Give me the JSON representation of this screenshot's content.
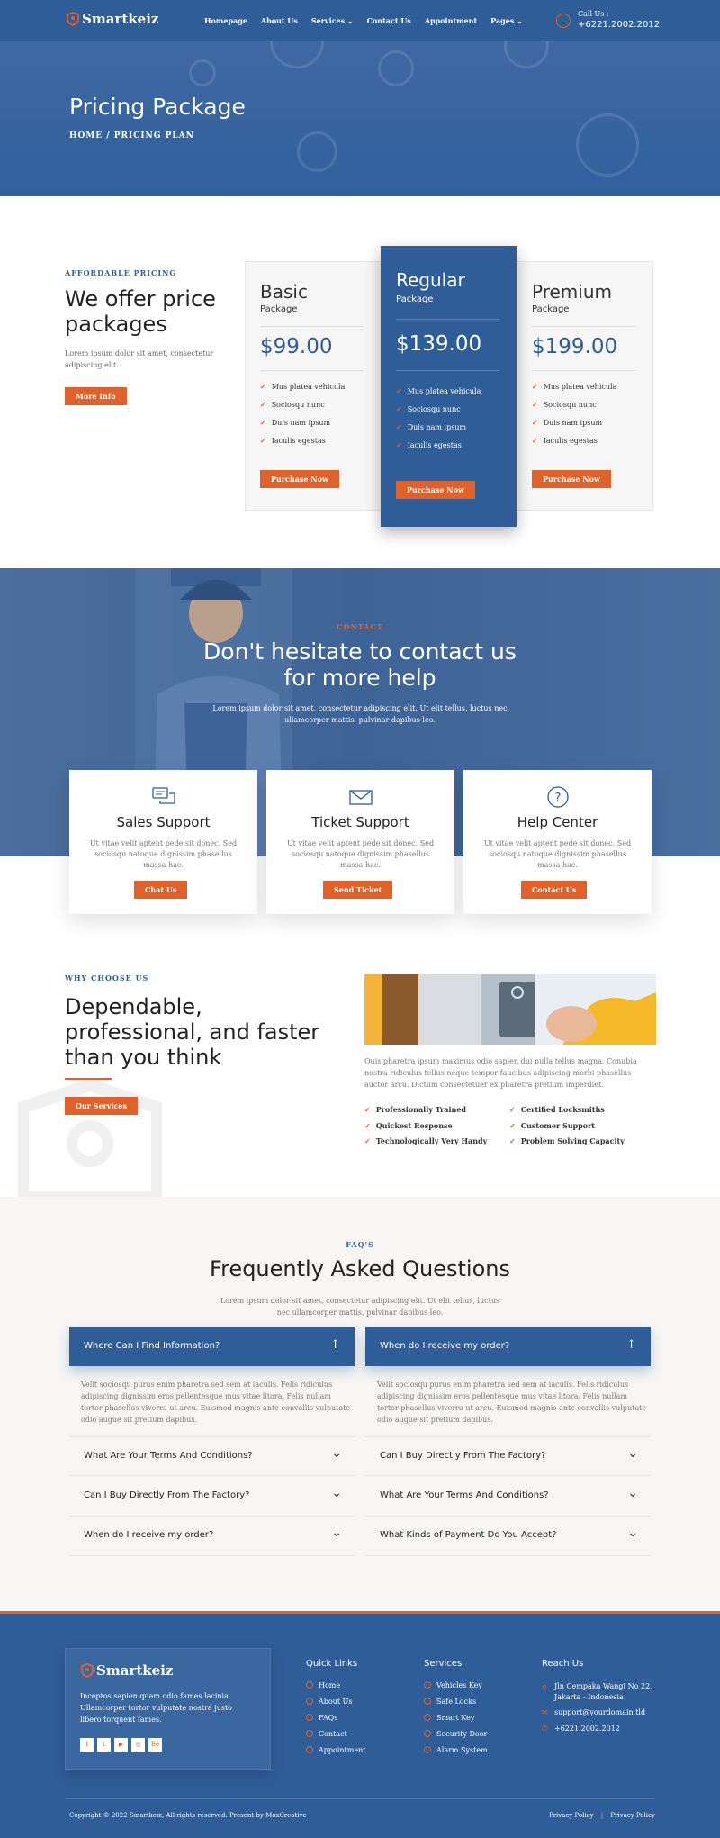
{
  "header": {
    "logo": "Smartkeiz",
    "nav": [
      "Homepage",
      "About Us",
      "Services",
      "Contact Us",
      "Appointment",
      "Pages"
    ],
    "call_label": "Call Us :",
    "call_number": "+6221.2002.2012"
  },
  "hero": {
    "title": "Pricing Package",
    "breadcrumb": "HOME  /  PRICING PLAN"
  },
  "pricing": {
    "eyebrow": "AFFORDABLE PRICING",
    "title": "We offer price packages",
    "desc": "Lorem ipsum dolor sit amet, consectetur adipiscing elit.",
    "more_btn": "More Info",
    "plans": [
      {
        "name": "Basic",
        "sub": "Package",
        "price": "$99.00",
        "features": [
          "Mus platea vehicula",
          "Sociosqu nunc",
          "Duis nam ipsum",
          "Iaculis egestas"
        ],
        "btn": "Purchase Now"
      },
      {
        "name": "Regular",
        "sub": "Package",
        "price": "$139.00",
        "features": [
          "Mus platea vehicula",
          "Sociosqu nunc",
          "Duis nam ipsum",
          "Iaculis egestas"
        ],
        "btn": "Purchase Now"
      },
      {
        "name": "Premium",
        "sub": "Package",
        "price": "$199.00",
        "features": [
          "Mus platea vehicula",
          "Sociosqu nunc",
          "Duis nam ipsum",
          "Iaculis egestas"
        ],
        "btn": "Purchase Now"
      }
    ]
  },
  "contact": {
    "eyebrow": "CONTACT",
    "title": "Don't hesitate to contact us for more help",
    "desc": "Lorem ipsum dolor sit amet, consectetur adipiscing elit. Ut elit tellus, luctus nec ullamcorper mattis, pulvinar dapibus leo.",
    "cards": [
      {
        "icon": "chat-bubbles-icon",
        "title": "Sales Support",
        "text": "Ut vitae velit aptent pede sit donec. Sed sociosqu natoque dignissim phasellus massa hac.",
        "btn": "Chat Us"
      },
      {
        "icon": "envelope-icon",
        "title": "Ticket Support",
        "text": "Ut vitae velit aptent pede sit donec. Sed sociosqu natoque dignissim phasellus massa hac.",
        "btn": "Send Ticket"
      },
      {
        "icon": "question-circle-icon",
        "title": "Help Center",
        "text": "Ut vitae velit aptent pede sit donec. Sed sociosqu natoque dignissim phasellus massa hac.",
        "btn": "Contact Us"
      }
    ]
  },
  "why": {
    "eyebrow": "WHY CHOOSE US",
    "title": "Dependable, professional, and faster than you think",
    "btn": "Our Services",
    "desc": "Quis pharetra ipsum maximus odio sapien dui nulla tellus magna. Conubia nostra ridiculus tellus neque tempor faucibus adipiscing morbi phasellus auctor arcu. Dictum consectetuer ex pharetra pretium imperdiet.",
    "features": [
      "Professionally Trained",
      "Certified Locksmiths",
      "Quickest Response",
      "Customer Support",
      "Technologically Very Handy",
      "Problem Solving Capacity"
    ]
  },
  "faq": {
    "eyebrow": "FAQ'S",
    "title": "Frequently Asked Questions",
    "desc": "Lorem ipsum dolor sit amet, consectetur adipiscing elit. Ut elit tellus, luctus nec ullamcorper mattis, pulvinar dapibus leo.",
    "answer": "Velit sociosqu purus enim pharetra sed sem at iaculis. Felis ridiculus adipiscing dignissim eros pellentesque mus vitae litora. Felis nullam tortor phasellus viverra ut arcu. Euismod magnis ante convallis vulputate odio augue sit pretium dapibus.",
    "left": [
      "Where Can I Find Information?",
      "What Are Your Terms And Conditions?",
      "Can I Buy Directly From The Factory?",
      "When do I receive my order?"
    ],
    "right": [
      "When do I receive my order?",
      "Can I Buy Directly From The Factory?",
      "What Are Your Terms And Conditions?",
      "What Kinds of Payment Do You Accept?"
    ]
  },
  "footer": {
    "logo": "Smartkeiz",
    "desc": "Inceptos sapien quam odio fames lacinia. Ullamcorper tortor vulputate nostra justo libero torquent fames.",
    "social": [
      "f",
      "t",
      "▶",
      "◎",
      "Bē"
    ],
    "quick_title": "Quick Links",
    "quick": [
      "Home",
      "About Us",
      "FAQs",
      "Contact",
      "Appointment"
    ],
    "services_title": "Services",
    "services": [
      "Vehicles Key",
      "Safe Locks",
      "Smart Key",
      "Security Door",
      "Alarm System"
    ],
    "reach_title": "Reach Us",
    "address": "Jln Cempaka Wangi No 22, Jakarta - Indonesia",
    "email": "support@yourdomain.tld",
    "phone": "+6221.2002.2012",
    "copyright": "Copyright © 2022 Smartkeiz, All rights reserved. Present by MoxCreative",
    "links": [
      "Privacy Policy",
      "Privacy Policy"
    ]
  },
  "colors": {
    "primary": "#2f5d97",
    "accent": "#e0622a"
  }
}
